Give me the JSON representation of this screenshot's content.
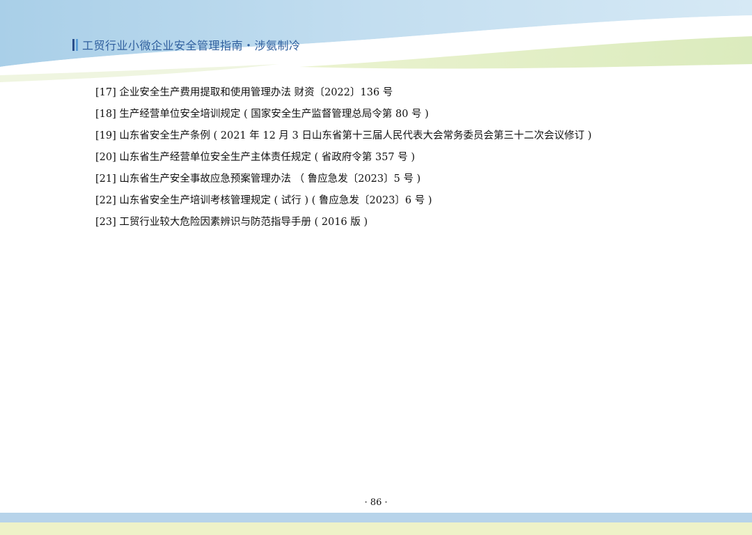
{
  "header": {
    "title": "工贸行业小微企业安全管理指南・涉氨制冷"
  },
  "references": [
    "[17] 企业安全生产费用提取和使用管理办法 财资〔2022〕136 号",
    "[18] 生产经营单位安全培训规定 ( 国家安全生产监督管理总局令第 80 号 )",
    "[19] 山东省安全生产条例 ( 2021 年 12 月 3 日山东省第十三届人民代表大会常务委员会第三十二次会议修订 )",
    "[20] 山东省生产经营单位安全生产主体责任规定 ( 省政府令第 357 号 )",
    "[21] 山东省生产安全事故应急预案管理办法 （ 鲁应急发〔2023〕5 号 )",
    "[22] 山东省安全生产培训考核管理规定 ( 试行 ) ( 鲁应急发〔2023〕6 号 )",
    "[23] 工贸行业较大危险因素辨识与防范指导手册 ( 2016 版 )"
  ],
  "footer": {
    "page_number": "· 86 ·"
  },
  "colors": {
    "header_blue": "#bcd9ec",
    "header_green": "#dcebb8",
    "title_blue": "#2f5f9e",
    "bar_dark": "#2a4f8c",
    "bar_light": "#5fa0d8",
    "footer_blue": "#b7d3ea",
    "footer_yellow": "#eef2c8"
  }
}
